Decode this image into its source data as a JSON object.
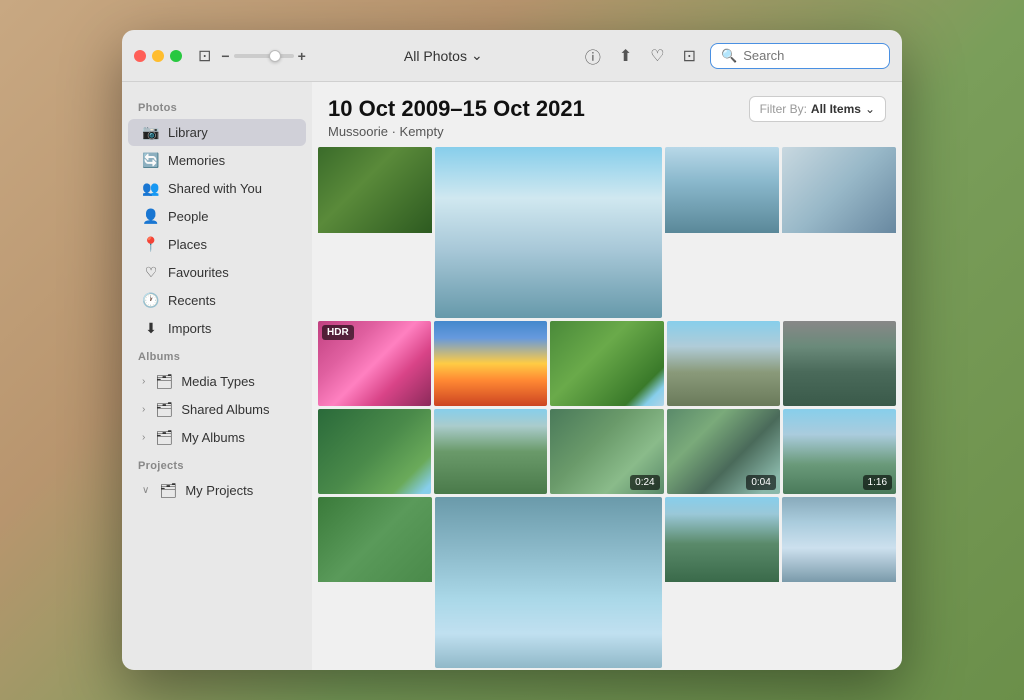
{
  "window": {
    "title": "Photos"
  },
  "titlebar": {
    "traffic_lights": [
      "close",
      "minimize",
      "maximize"
    ],
    "view_icon": "⊞",
    "zoom_minus": "−",
    "zoom_plus": "+",
    "all_photos_label": "All Photos",
    "chevron": "⌃",
    "info_icon": "ℹ",
    "share_icon": "⎋",
    "heart_icon": "♡",
    "crop_icon": "⊡",
    "search_placeholder": "Search"
  },
  "sidebar": {
    "sections": [
      {
        "header": "Photos",
        "items": [
          {
            "id": "library",
            "label": "Library",
            "icon": "📷",
            "active": true
          },
          {
            "id": "memories",
            "label": "Memories",
            "icon": "🔄"
          },
          {
            "id": "shared-with-you",
            "label": "Shared with You",
            "icon": "👥"
          },
          {
            "id": "people",
            "label": "People",
            "icon": "👤"
          },
          {
            "id": "places",
            "label": "Places",
            "icon": "📍"
          },
          {
            "id": "favourites",
            "label": "Favourites",
            "icon": "♡"
          },
          {
            "id": "recents",
            "label": "Recents",
            "icon": "🕐"
          },
          {
            "id": "imports",
            "label": "Imports",
            "icon": "⬇"
          }
        ]
      },
      {
        "header": "Albums",
        "items": [
          {
            "id": "media-types",
            "label": "Media Types",
            "icon": "🗂",
            "arrow": "›"
          },
          {
            "id": "shared-albums",
            "label": "Shared Albums",
            "icon": "🗂",
            "arrow": "›"
          },
          {
            "id": "my-albums",
            "label": "My Albums",
            "icon": "🗂",
            "arrow": "›"
          }
        ]
      },
      {
        "header": "Projects",
        "items": [
          {
            "id": "my-projects",
            "label": "My Projects",
            "icon": "🗂",
            "arrow": "∨"
          }
        ]
      }
    ]
  },
  "main": {
    "date_range": "10 Oct 2009–15 Oct 2021",
    "location": "Mussoorie · Kempty",
    "filter_label": "Filter By:",
    "filter_value": "All Items",
    "photos": [
      [
        {
          "id": "p1",
          "class": "photo-green-leaf",
          "span": 1
        },
        {
          "id": "p2",
          "class": "photo-waterfall-wide",
          "span": 2
        },
        {
          "id": "p3",
          "class": "photo-waterfall-blue",
          "span": 1
        },
        {
          "id": "p4",
          "class": "photo-waterfall-mist",
          "span": 1
        }
      ],
      [
        {
          "id": "p5",
          "class": "photo-pink-flowers",
          "badge": "HDR"
        },
        {
          "id": "p6",
          "class": "photo-sunset-mountains"
        },
        {
          "id": "p7",
          "class": "photo-green-hills"
        },
        {
          "id": "p8",
          "class": "photo-rocky-hills"
        },
        {
          "id": "p9",
          "class": "photo-mountain-dark"
        }
      ],
      [
        {
          "id": "p10",
          "class": "photo-forest-trees"
        },
        {
          "id": "p11",
          "class": "photo-village-hill"
        },
        {
          "id": "p12",
          "class": "photo-river-bridge",
          "duration": "0:24"
        },
        {
          "id": "p13",
          "class": "photo-stream-rocks",
          "duration": "0:04"
        },
        {
          "id": "p14",
          "class": "photo-mountain-view",
          "duration": "1:16"
        }
      ],
      [
        {
          "id": "p15",
          "class": "photo-green-forest2"
        },
        {
          "id": "p16",
          "class": "photo-waterfall2",
          "span": 2
        },
        {
          "id": "p17",
          "class": "photo-forest-mountain"
        },
        {
          "id": "p18",
          "class": "photo-waterfall3"
        }
      ]
    ]
  }
}
